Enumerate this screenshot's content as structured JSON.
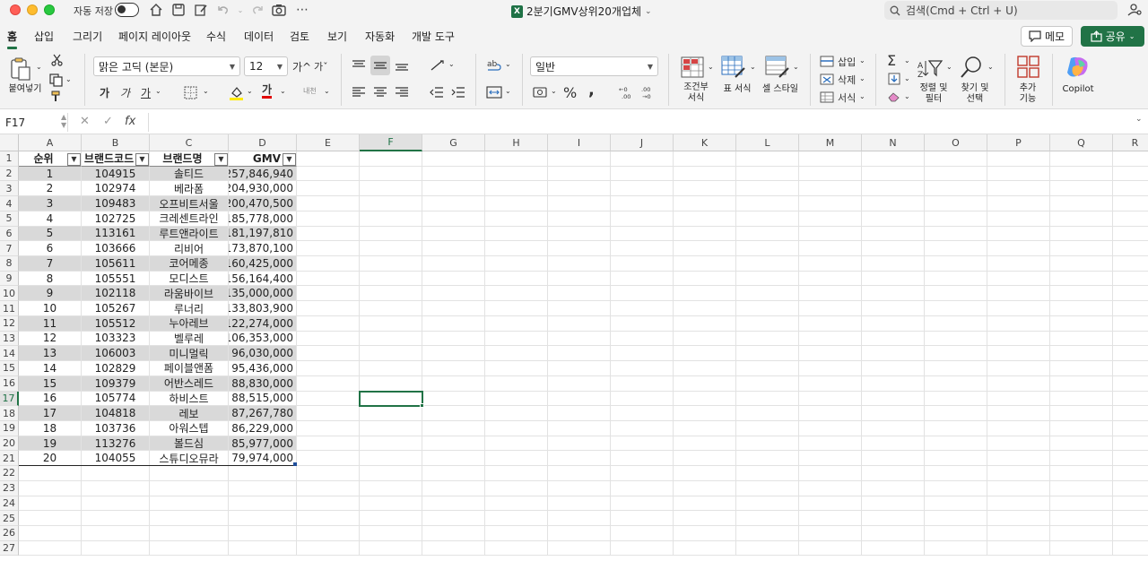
{
  "titlebar": {
    "autosave_label": "자동 저장",
    "doc_title": "2분기GMV상위20개업체",
    "search_placeholder": "검색(Cmd + Ctrl + U)"
  },
  "tabs": [
    {
      "label": "홈",
      "active": true
    },
    {
      "label": "삽입"
    },
    {
      "label": "그리기"
    },
    {
      "label": "페이지 레이아웃"
    },
    {
      "label": "수식"
    },
    {
      "label": "데이터"
    },
    {
      "label": "검토"
    },
    {
      "label": "보기"
    },
    {
      "label": "자동화"
    },
    {
      "label": "개발 도구"
    }
  ],
  "actions": {
    "memo": "메모",
    "share": "공유"
  },
  "ribbon": {
    "paste": "붙여넣기",
    "font_name": "맑은 고딕 (본문)",
    "font_size": "12",
    "grow_font": "가^",
    "shrink_font": "가ˇ",
    "bold": "가",
    "italic": "가",
    "underline": "가",
    "font_color_glyph": "가",
    "phonetic": "내천",
    "number_format": "일반",
    "percent": "%",
    "comma": ",",
    "conditional_format": "조건부\n서식",
    "table_format": "표 서식",
    "cell_style": "셀 스타일",
    "insert": "삽입",
    "delete": "삭제",
    "format": "서식",
    "sort_filter": "정렬 및\n필터",
    "find_select": "찾기 및\n선택",
    "addins": "추가\n기능",
    "copilot": "Copilot"
  },
  "formula_bar": {
    "name_box": "F17",
    "fx": "fx",
    "formula": ""
  },
  "columns": [
    "A",
    "B",
    "C",
    "D",
    "E",
    "F",
    "G",
    "H",
    "I",
    "J",
    "K",
    "L",
    "M",
    "N",
    "O",
    "P",
    "Q",
    "R"
  ],
  "selected_cell": {
    "col": "F",
    "row": 17
  },
  "table": {
    "headers": [
      "순위",
      "브랜드코드",
      "브랜드명",
      "GMV"
    ],
    "rows": [
      [
        "1",
        "104915",
        "솔티드",
        "257,846,940"
      ],
      [
        "2",
        "102974",
        "베라폼",
        "204,930,000"
      ],
      [
        "3",
        "109483",
        "오프비트서울",
        "200,470,500"
      ],
      [
        "4",
        "102725",
        "크레센트라인",
        "185,778,000"
      ],
      [
        "5",
        "113161",
        "루트앤라이트",
        "181,197,810"
      ],
      [
        "6",
        "103666",
        "리비어",
        "173,870,100"
      ],
      [
        "7",
        "105611",
        "코어메종",
        "160,425,000"
      ],
      [
        "8",
        "105551",
        "모디스트",
        "156,164,400"
      ],
      [
        "9",
        "102118",
        "라움바이브",
        "135,000,000"
      ],
      [
        "10",
        "105267",
        "루너리",
        "133,803,900"
      ],
      [
        "11",
        "105512",
        "누아레브",
        "122,274,000"
      ],
      [
        "12",
        "103323",
        "벨루레",
        "106,353,000"
      ],
      [
        "13",
        "106003",
        "미니멀릭",
        "96,030,000"
      ],
      [
        "14",
        "102829",
        "페이블앤폼",
        "95,436,000"
      ],
      [
        "15",
        "109379",
        "어반스레드",
        "88,830,000"
      ],
      [
        "16",
        "105774",
        "하비스트",
        "88,515,000"
      ],
      [
        "17",
        "104818",
        "레보",
        "87,267,780"
      ],
      [
        "18",
        "103736",
        "아워스텝",
        "86,229,000"
      ],
      [
        "19",
        "113276",
        "볼드심",
        "85,977,000"
      ],
      [
        "20",
        "104055",
        "스튜디오뮤라",
        "79,974,000"
      ]
    ]
  },
  "row_numbers": [
    "1",
    "2",
    "3",
    "4",
    "5",
    "6",
    "7",
    "8",
    "9",
    "10",
    "11",
    "12",
    "13",
    "14",
    "15",
    "16",
    "17",
    "18",
    "19",
    "20",
    "21",
    "22",
    "23",
    "24",
    "25",
    "26",
    "27"
  ]
}
